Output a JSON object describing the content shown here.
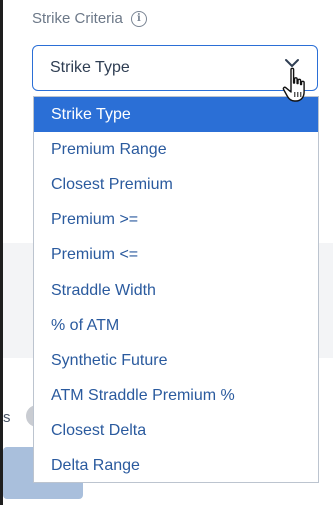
{
  "field": {
    "label": "Strike Criteria",
    "info_glyph": "i",
    "selected_value": "Strike Type"
  },
  "dropdown": {
    "options": [
      {
        "label": "Strike Type",
        "selected": true
      },
      {
        "label": "Premium Range",
        "selected": false
      },
      {
        "label": "Closest Premium",
        "selected": false
      },
      {
        "label": "Premium >=",
        "selected": false
      },
      {
        "label": "Premium <=",
        "selected": false
      },
      {
        "label": "Straddle Width",
        "selected": false
      },
      {
        "label": "% of ATM",
        "selected": false
      },
      {
        "label": "Synthetic Future",
        "selected": false
      },
      {
        "label": "ATM Straddle Premium %",
        "selected": false
      },
      {
        "label": "Closest Delta",
        "selected": false
      },
      {
        "label": "Delta Range",
        "selected": false
      }
    ]
  },
  "background": {
    "partial_text": "s"
  },
  "colors": {
    "accent": "#2b6fd6",
    "option_text": "#2a5a9e",
    "label_text": "#6c7888"
  },
  "icons": {
    "info": "info-icon",
    "chevron": "chevron-down-icon",
    "cursor": "hand-pointer-cursor"
  }
}
